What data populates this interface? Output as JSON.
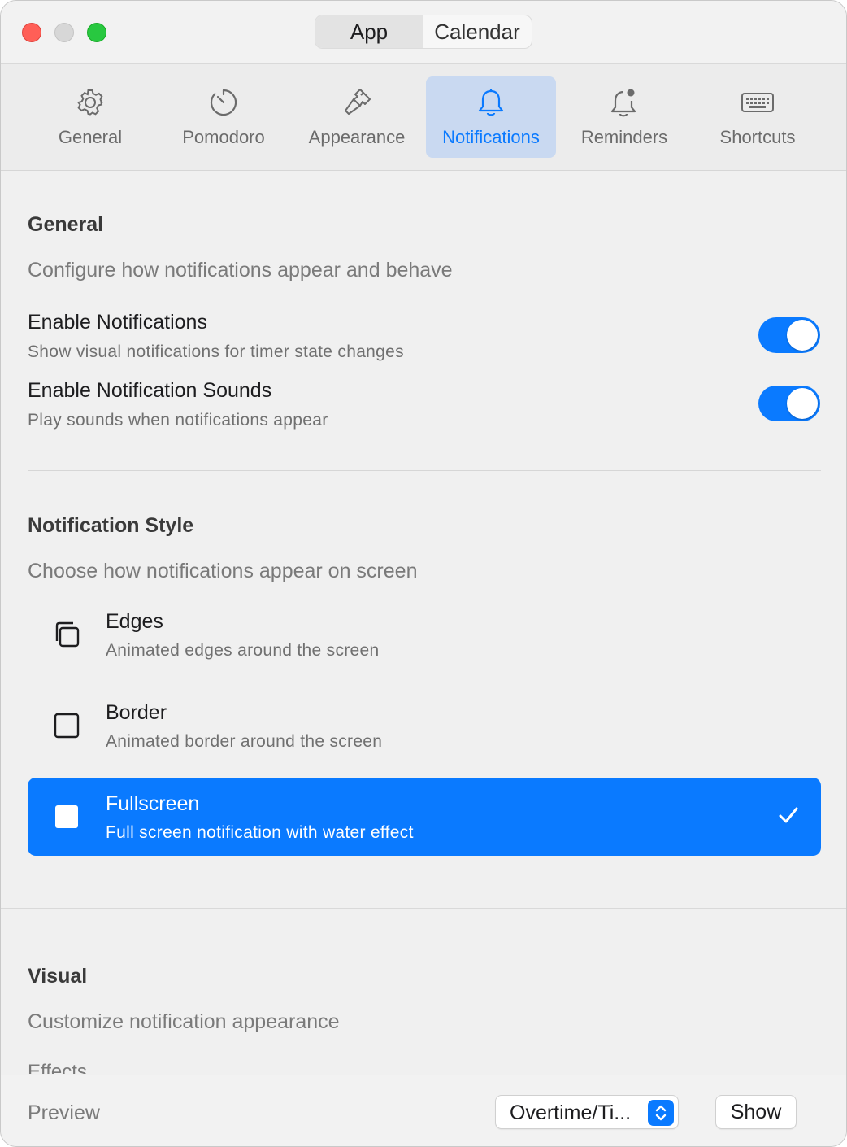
{
  "window": {
    "segments": [
      {
        "label": "App",
        "active": true
      },
      {
        "label": "Calendar",
        "active": false
      }
    ]
  },
  "tabs": [
    {
      "label": "General",
      "icon": "gear-icon"
    },
    {
      "label": "Pomodoro",
      "icon": "timer-icon"
    },
    {
      "label": "Appearance",
      "icon": "paintbrush-icon"
    },
    {
      "label": "Notifications",
      "icon": "bell-icon",
      "active": true
    },
    {
      "label": "Reminders",
      "icon": "bell-badge-icon"
    },
    {
      "label": "Shortcuts",
      "icon": "keyboard-icon"
    }
  ],
  "general": {
    "title": "General",
    "subtitle": "Configure how notifications appear and behave",
    "rows": [
      {
        "title": "Enable Notifications",
        "desc": "Show visual notifications for timer state changes",
        "on": true
      },
      {
        "title": "Enable Notification Sounds",
        "desc": "Play sounds when notifications appear",
        "on": true
      }
    ]
  },
  "style": {
    "title": "Notification Style",
    "subtitle": "Choose how notifications appear on screen",
    "options": [
      {
        "title": "Edges",
        "desc": "Animated edges around the screen",
        "icon": "square-on-square-icon",
        "selected": false
      },
      {
        "title": "Border",
        "desc": "Animated border around the screen",
        "icon": "square-icon",
        "selected": false
      },
      {
        "title": "Fullscreen",
        "desc": "Full screen notification with water effect",
        "icon": "square-fill-icon",
        "selected": true
      }
    ]
  },
  "visual": {
    "title": "Visual",
    "subtitle": "Customize notification appearance",
    "next_heading": "Effects"
  },
  "footer": {
    "preview_label": "Preview",
    "select_value": "Overtime/Ti...",
    "show_button": "Show"
  },
  "colors": {
    "accent": "#0a7aff",
    "tab_active_bg": "#c9d9f1"
  }
}
